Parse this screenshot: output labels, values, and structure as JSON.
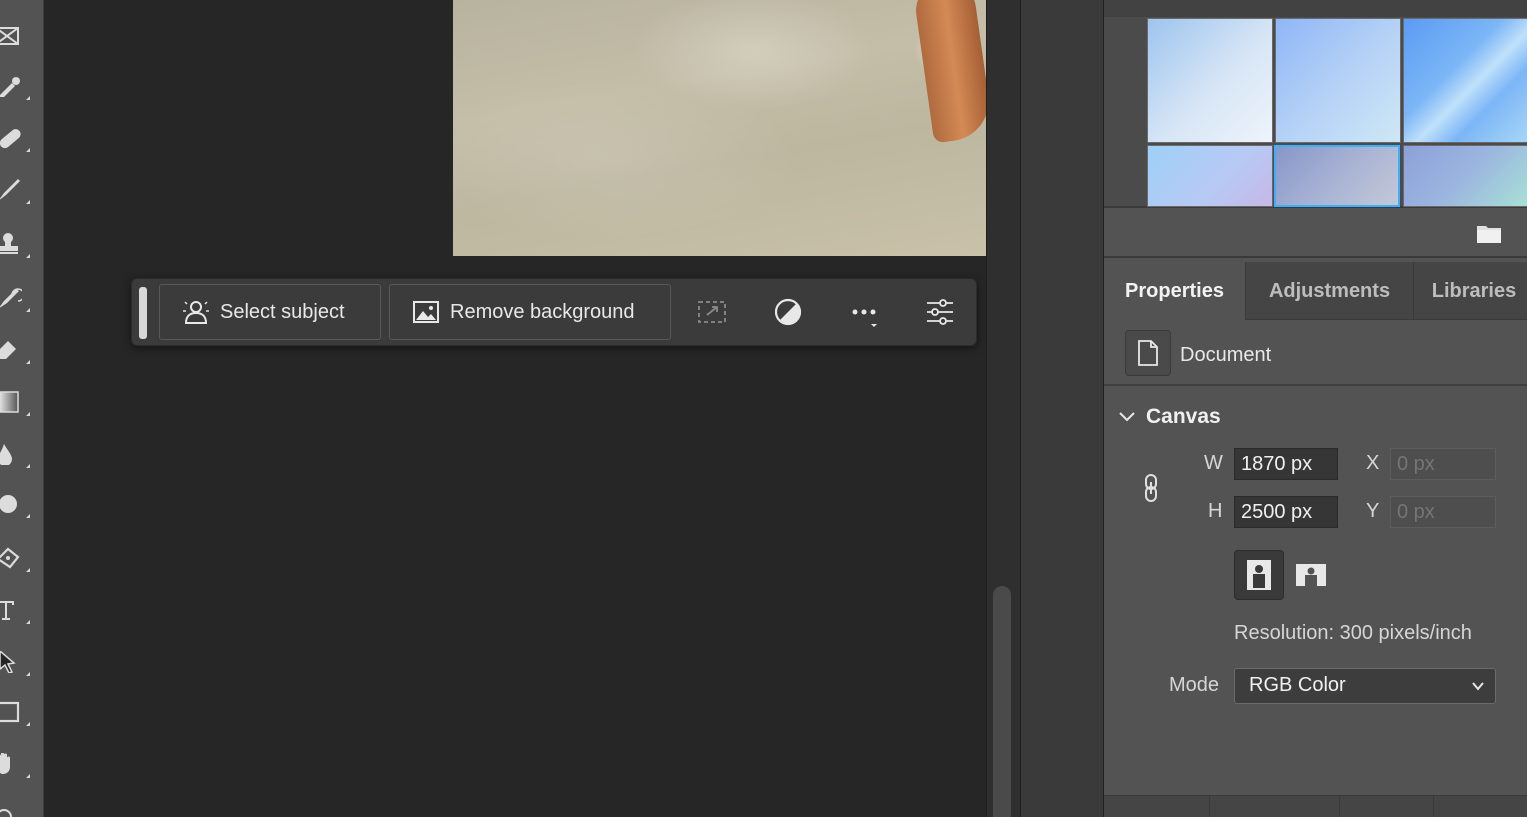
{
  "taskbar": {
    "select_subject_label": "Select subject",
    "remove_background_label": "Remove background"
  },
  "properties": {
    "tabs": [
      {
        "label": "Properties"
      },
      {
        "label": "Adjustments"
      },
      {
        "label": "Libraries"
      }
    ],
    "document_label": "Document",
    "canvas": {
      "title": "Canvas",
      "w_label": "W",
      "w_value": "1870 px",
      "h_label": "H",
      "h_value": "2500 px",
      "x_label": "X",
      "x_placeholder": "0 px",
      "y_label": "Y",
      "y_placeholder": "0 px",
      "resolution": "Resolution: 300 pixels/inch",
      "mode_label": "Mode",
      "mode_value": "RGB Color"
    }
  },
  "colors": {
    "accent_selected": "#3ab0ff"
  }
}
